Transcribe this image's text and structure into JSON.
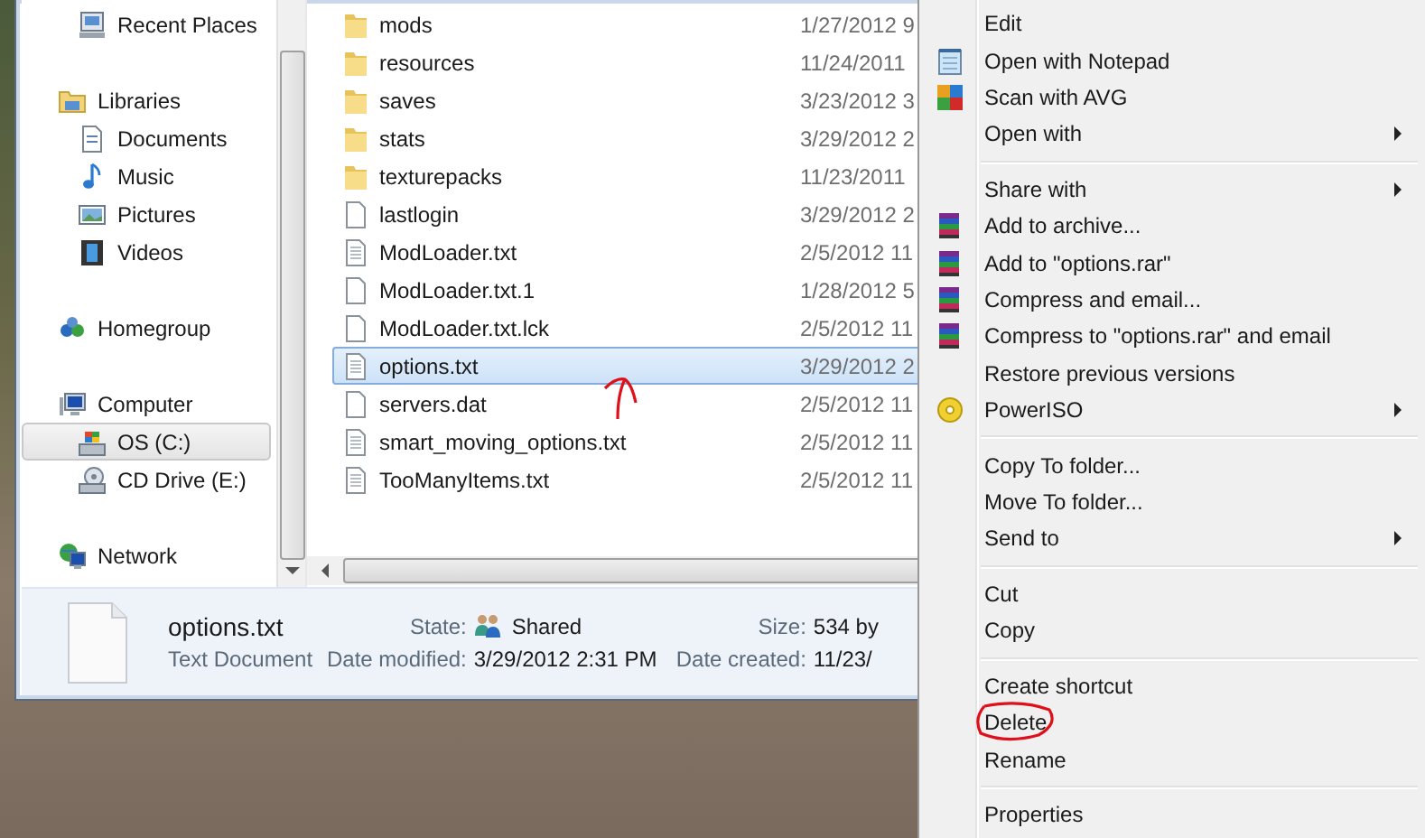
{
  "navigation_pane": {
    "favorites": [
      {
        "label": "Recent Places",
        "kind": "recent",
        "selected": false
      }
    ],
    "tree": [
      {
        "label": "Libraries",
        "kind": "library",
        "selected": false,
        "children": [
          {
            "label": "Documents",
            "kind": "documents",
            "selected": false
          },
          {
            "label": "Music",
            "kind": "music",
            "selected": false
          },
          {
            "label": "Pictures",
            "kind": "pictures",
            "selected": false
          },
          {
            "label": "Videos",
            "kind": "videos",
            "selected": false
          }
        ]
      },
      {
        "label": "Homegroup",
        "kind": "homegroup",
        "selected": false
      },
      {
        "label": "Computer",
        "kind": "computer",
        "selected": false,
        "children": [
          {
            "label": "OS (C:)",
            "kind": "drive",
            "selected": true
          },
          {
            "label": "CD Drive (E:)",
            "kind": "cd",
            "selected": false
          }
        ]
      },
      {
        "label": "Network",
        "kind": "network",
        "selected": false
      }
    ]
  },
  "files": [
    {
      "name": "mods",
      "kind": "folder",
      "date": "1/27/2012 9",
      "selected": false,
      "marked": false
    },
    {
      "name": "resources",
      "kind": "folder",
      "date": "11/24/2011",
      "selected": false,
      "marked": false
    },
    {
      "name": "saves",
      "kind": "folder",
      "date": "3/23/2012 3",
      "selected": false,
      "marked": false
    },
    {
      "name": "stats",
      "kind": "folder",
      "date": "3/29/2012 2",
      "selected": false,
      "marked": false
    },
    {
      "name": "texturepacks",
      "kind": "folder",
      "date": "11/23/2011",
      "selected": false,
      "marked": false
    },
    {
      "name": "lastlogin",
      "kind": "file",
      "date": "3/29/2012 2",
      "selected": false,
      "marked": false
    },
    {
      "name": "ModLoader.txt",
      "kind": "text",
      "date": "2/5/2012 11",
      "selected": false,
      "marked": false
    },
    {
      "name": "ModLoader.txt.1",
      "kind": "file",
      "date": "1/28/2012 5",
      "selected": false,
      "marked": false
    },
    {
      "name": "ModLoader.txt.lck",
      "kind": "file",
      "date": "2/5/2012 11",
      "selected": false,
      "marked": false
    },
    {
      "name": "options.txt",
      "kind": "text",
      "date": "3/29/2012 2",
      "selected": true,
      "marked": true
    },
    {
      "name": "servers.dat",
      "kind": "file",
      "date": "2/5/2012 11",
      "selected": false,
      "marked": false
    },
    {
      "name": "smart_moving_options.txt",
      "kind": "text",
      "date": "2/5/2012 11",
      "selected": false,
      "marked": false
    },
    {
      "name": "TooManyItems.txt",
      "kind": "text",
      "date": "2/5/2012 11",
      "selected": false,
      "marked": false
    }
  ],
  "details_pane": {
    "name": "options.txt",
    "type": "Text Document",
    "state_label": "State:",
    "state": "Shared",
    "modified_label": "Date modified:",
    "modified": "3/29/2012 2:31 PM",
    "size_label": "Size:",
    "size": "534 by",
    "created_label": "Date created:",
    "created": "11/23/"
  },
  "context_menu": [
    [
      {
        "label": "Edit",
        "kind": "plain",
        "submenu": false,
        "circled": false
      },
      {
        "label": "Open with Notepad",
        "kind": "notepad",
        "submenu": false,
        "circled": false
      },
      {
        "label": "Scan with AVG",
        "kind": "antivirus",
        "submenu": false,
        "circled": false
      },
      {
        "label": "Open with",
        "kind": "plain",
        "submenu": true,
        "circled": false
      }
    ],
    [
      {
        "label": "Share with",
        "kind": "plain",
        "submenu": true,
        "circled": false
      },
      {
        "label": "Add to archive...",
        "kind": "archive",
        "submenu": false,
        "circled": false
      },
      {
        "label": "Add to \"options.rar\"",
        "kind": "archive",
        "submenu": false,
        "circled": false
      },
      {
        "label": "Compress and email...",
        "kind": "archive",
        "submenu": false,
        "circled": false
      },
      {
        "label": "Compress to \"options.rar\" and email",
        "kind": "archive",
        "submenu": false,
        "circled": false
      },
      {
        "label": "Restore previous versions",
        "kind": "plain",
        "submenu": false,
        "circled": false
      },
      {
        "label": "PowerISO",
        "kind": "disc",
        "submenu": true,
        "circled": false
      }
    ],
    [
      {
        "label": "Copy To folder...",
        "kind": "plain",
        "submenu": false,
        "circled": false
      },
      {
        "label": "Move To folder...",
        "kind": "plain",
        "submenu": false,
        "circled": false
      },
      {
        "label": "Send to",
        "kind": "plain",
        "submenu": true,
        "circled": false
      }
    ],
    [
      {
        "label": "Cut",
        "kind": "plain",
        "submenu": false,
        "circled": false
      },
      {
        "label": "Copy",
        "kind": "plain",
        "submenu": false,
        "circled": false
      }
    ],
    [
      {
        "label": "Create shortcut",
        "kind": "plain",
        "submenu": false,
        "circled": false
      },
      {
        "label": "Delete",
        "kind": "plain",
        "submenu": false,
        "circled": true
      },
      {
        "label": "Rename",
        "kind": "plain",
        "submenu": false,
        "circled": false
      }
    ],
    [
      {
        "label": "Properties",
        "kind": "plain",
        "submenu": false,
        "circled": false
      }
    ]
  ]
}
